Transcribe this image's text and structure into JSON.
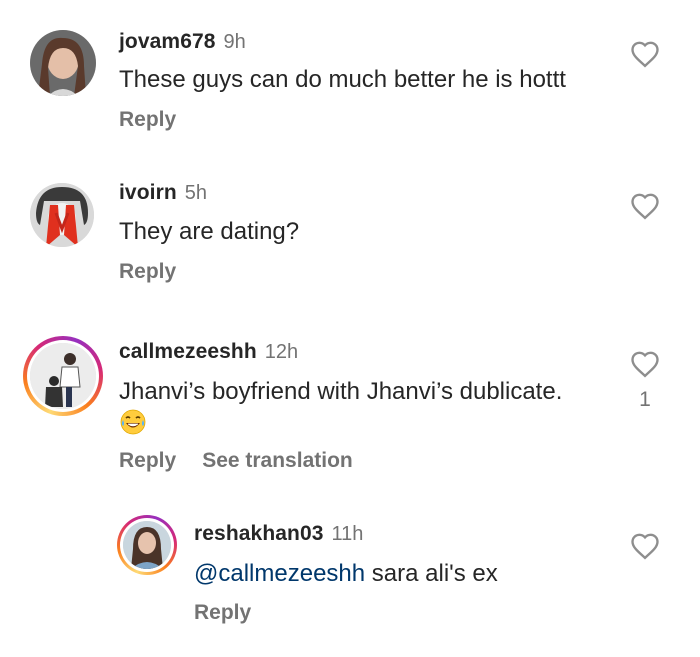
{
  "comments": [
    {
      "username": "jovam678",
      "time": "9h",
      "text": "These guys can do much better he is hottt",
      "reply_label": "Reply"
    },
    {
      "username": "ivoirn",
      "time": "5h",
      "text": "They are dating?",
      "reply_label": "Reply"
    },
    {
      "username": "callmezeeshh",
      "time": "12h",
      "text": "Jhanvi’s boyfriend with Jhanvi’s dublicate.",
      "emoji": "face-with-tears-of-joy",
      "reply_label": "Reply",
      "translate_label": "See translation",
      "like_count": "1",
      "avatar_ring": true
    }
  ],
  "reply": {
    "username": "reshakhan03",
    "time": "11h",
    "mention": "@callmezeeshh",
    "text": " sara ali's ex",
    "reply_label": "Reply",
    "avatar_ring": true
  },
  "icons": {
    "like": "heart-outline-icon",
    "emoji": "tears-of-joy-emoji"
  },
  "colors": {
    "username": "#262626",
    "secondary": "#737373",
    "mention": "#00376b",
    "ring_start": "#feda75",
    "ring_end": "#962fbf"
  }
}
